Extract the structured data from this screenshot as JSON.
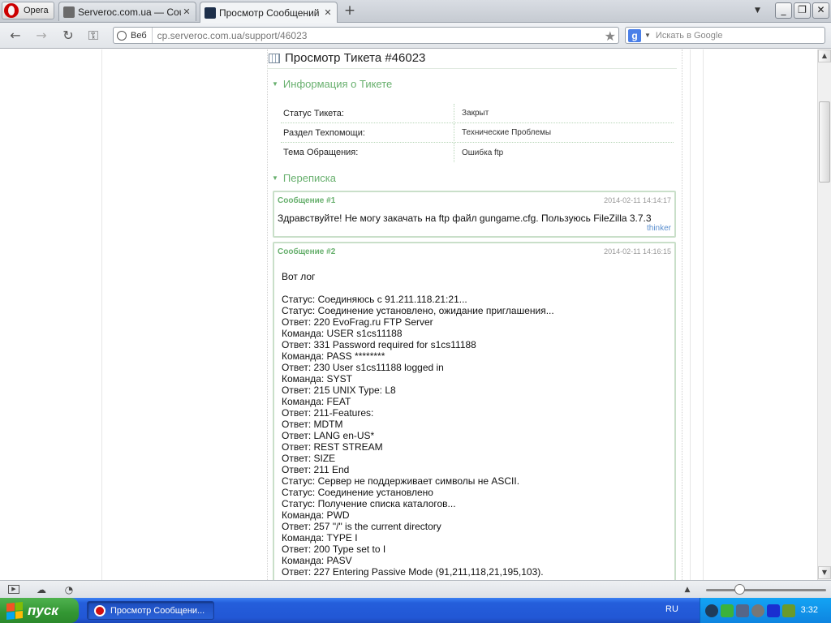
{
  "browser": {
    "menu_label": "Opera",
    "tabs": [
      {
        "title": "Serveroc.com.ua — Cou...",
        "close": "✕"
      },
      {
        "title": "Просмотр Сообщений • ...",
        "close": "✕"
      }
    ],
    "new_tab": "+",
    "address": {
      "badge": "Веб",
      "host": "cp.serveroc.com.ua",
      "path": "/support/46023"
    },
    "search": {
      "placeholder": "Искать в Google",
      "engine": "g"
    },
    "window_controls": {
      "minimize": "_",
      "restore": "❐",
      "close": "✕"
    }
  },
  "page": {
    "title": "Просмотр Тикета #46023",
    "info_section": "Информация о Тикете",
    "info": [
      {
        "key": "Статус Тикета:",
        "value": "Закрыт"
      },
      {
        "key": "Раздел Техпомощи:",
        "value": "Технические Проблемы"
      },
      {
        "key": "Тема Обращения:",
        "value": "Ошибка ftp"
      }
    ],
    "correspondence_section": "Переписка",
    "messages": [
      {
        "number": "Сообщение #1",
        "date": "2014-02-11 14:14:17",
        "text": "Здравствуйте! Не могу закачать на ftp файл gungame.cfg. Пользуюсь FileZilla 3.7.3",
        "author": "thinker"
      },
      {
        "number": "Сообщение #2",
        "date": "2014-02-11 14:16:15",
        "intro": "Вот лог",
        "log": [
          "Статус: Соединяюсь с 91.211.118.21:21...",
          "Статус: Соединение установлено, ожидание приглашения...",
          "Ответ: 220 EvoFrag.ru FTP Server",
          "Команда: USER s1cs11188",
          "Ответ: 331 Password required for s1cs11188",
          "Команда: PASS ********",
          "Ответ: 230 User s1cs11188 logged in",
          "Команда: SYST",
          "Ответ: 215 UNIX Type: L8",
          "Команда: FEAT",
          "Ответ: 211-Features:",
          "Ответ: MDTM",
          "Ответ: LANG en-US*",
          "Ответ: REST STREAM",
          "Ответ: SIZE",
          "Ответ: 211 End",
          "Статус: Сервер не поддерживает символы не ASCII.",
          "Статус: Соединение установлено",
          "Статус: Получение списка каталогов...",
          "Команда: PWD",
          "Ответ: 257 \"/\" is the current directory",
          "Команда: TYPE I",
          "Ответ: 200 Type set to I",
          "Команда: PASV",
          "Ответ: 227 Entering Passive Mode (91,211,118,21,195,103)."
        ]
      }
    ]
  },
  "taskbar": {
    "start_label": "пуск",
    "task_title": "Просмотр Сообщени...",
    "language": "RU",
    "clock": "3:32"
  },
  "colors": {
    "accent_green": "#68b06e",
    "link_blue": "#5b8fcf",
    "taskbar_blue": "#245edb",
    "start_green": "#339633"
  }
}
